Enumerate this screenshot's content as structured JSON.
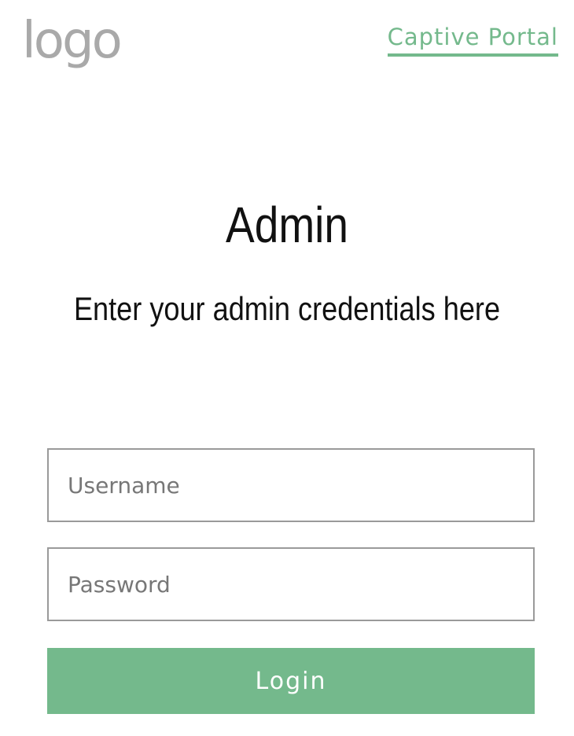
{
  "header": {
    "logo_text": "logo",
    "portal_link_label": "Captive Portal"
  },
  "main": {
    "title": "Admin",
    "subtitle": "Enter your admin credentials here"
  },
  "form": {
    "username": {
      "value": "",
      "placeholder": "Username"
    },
    "password": {
      "value": "",
      "placeholder": "Password"
    },
    "login_label": "Login"
  },
  "colors": {
    "accent": "#74b98c",
    "logo": "#a9a9a9",
    "text": "#111111",
    "input_border": "#9a9a9a"
  }
}
